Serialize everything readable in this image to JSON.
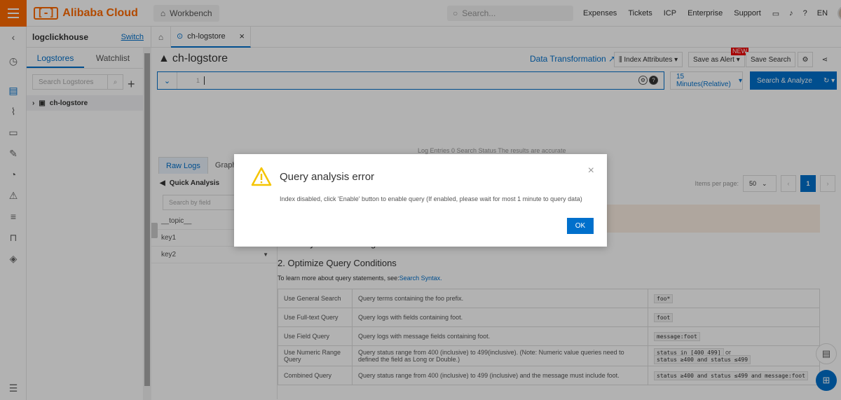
{
  "topbar": {
    "brand": "Alibaba Cloud",
    "workbench": "Workbench",
    "search_placeholder": "Search...",
    "links": [
      "Expenses",
      "Tickets",
      "ICP",
      "Enterprise",
      "Support"
    ],
    "lang": "EN"
  },
  "project": {
    "name": "logclickhouse",
    "switch_label": "Switch",
    "tabs": [
      "Logstores",
      "Watchlist"
    ],
    "search_placeholder": "Search Logstores",
    "logstore": "ch-logstore"
  },
  "main": {
    "tab_label": "ch-logstore",
    "title": "ch-logstore",
    "data_transformation": "Data Transformation",
    "index_attributes": "Index Attributes",
    "save_as_alert": "Save as Alert",
    "new_badge": "NEW",
    "save_search": "Save Search",
    "line_number": "1",
    "time_range": "15 Minutes(Relative)",
    "search_analyze": "Search & Analyze",
    "result_info": "Log Entries 0   Search Status The results are accurate",
    "raw_tabs": [
      "Raw Logs",
      "Graph"
    ],
    "quick_analysis": "Quick Analysis",
    "field_search_placeholder": "Search by field",
    "fields": [
      "__topic__",
      "key1",
      "key2"
    ],
    "items_per_page_label": "Items per page:",
    "items_per_page": "50",
    "current_page": "1",
    "section1_partial": "1. Modify the Date Range",
    "section2": "2. Optimize Query Conditions",
    "learn_more": "To learn more about query statements, see:",
    "learn_link": "Search Syntax.",
    "query_table": [
      {
        "name": "Use General Search",
        "desc": "Query terms containing the foo prefix.",
        "example": "foo*"
      },
      {
        "name": "Use Full-text Query",
        "desc": "Query logs with fields containing foot.",
        "example": "foot"
      },
      {
        "name": "Use Field Query",
        "desc": "Query logs with message fields containing foot.",
        "example": "message:foot"
      },
      {
        "name": "Use Numeric Range Query",
        "desc": "Query status range from 400 (inclusive) to 499(inclusive). (Note: Numeric value queries need to defined the field as Long or Double.)",
        "example": "status in [400 499]",
        "example_or": "or",
        "example2": "status ≥400 and status ≤499"
      },
      {
        "name": "Combined Query",
        "desc": "Query status range from 400 (inclusive) to 499 (inclusive) and the message must include foot.",
        "example": "status ≥400 and status ≤499 and message:foot"
      }
    ]
  },
  "modal": {
    "title": "Query analysis error",
    "message": "Index disabled, click 'Enable' button to enable query (If enabled, please wait for most 1 minute to query data)",
    "ok_label": "OK"
  },
  "colors": {
    "accent": "#0070cc",
    "brand": "#ff6a00",
    "warning": "#f5c400"
  }
}
